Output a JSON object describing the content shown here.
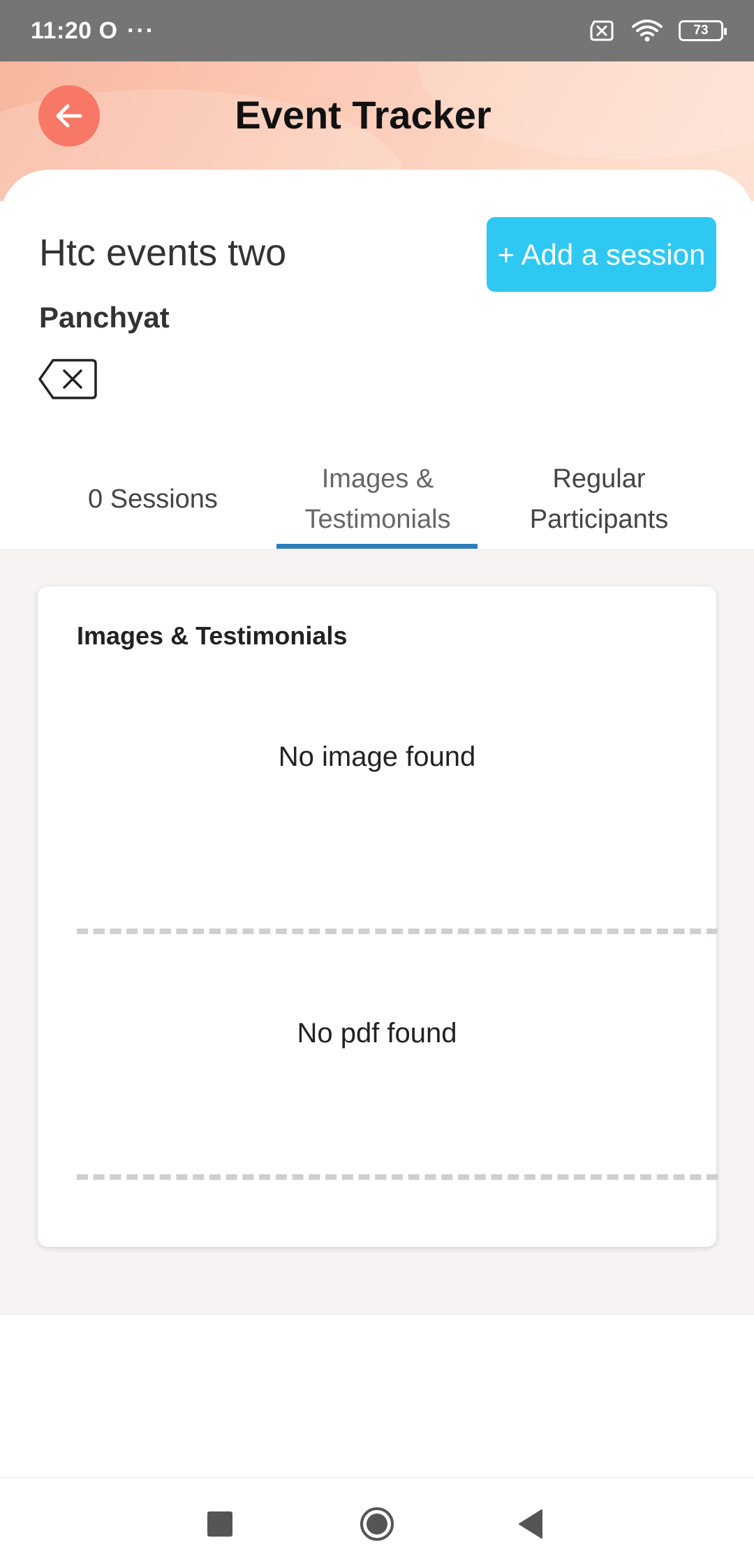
{
  "status_bar": {
    "time": "11:20",
    "indicator": "O",
    "overflow": "···",
    "battery_level": "73",
    "icons": [
      "no-sim-icon",
      "wifi-icon",
      "battery-icon"
    ]
  },
  "header": {
    "title": "Event Tracker",
    "back_icon": "arrow-left-icon",
    "accent_color": "#f77866"
  },
  "event": {
    "name": "Htc events two",
    "category": "Panchyat",
    "add_session_label": "+ Add a session",
    "add_button_color": "#2ec8f2",
    "delete_icon": "backspace-x-icon"
  },
  "tabs": [
    {
      "label": "0 Sessions",
      "selected": false
    },
    {
      "label": "Images & Testimonials",
      "selected": true
    },
    {
      "label": "Regular Participants",
      "selected": false
    }
  ],
  "tab_underline_color": "#2c7fbf",
  "media_card": {
    "title": "Images & Testimonials",
    "no_image_text": "No image found",
    "no_pdf_text": "No pdf found"
  },
  "nav_bar": {
    "icons": [
      "recent-apps-icon",
      "home-icon",
      "back-icon"
    ]
  }
}
